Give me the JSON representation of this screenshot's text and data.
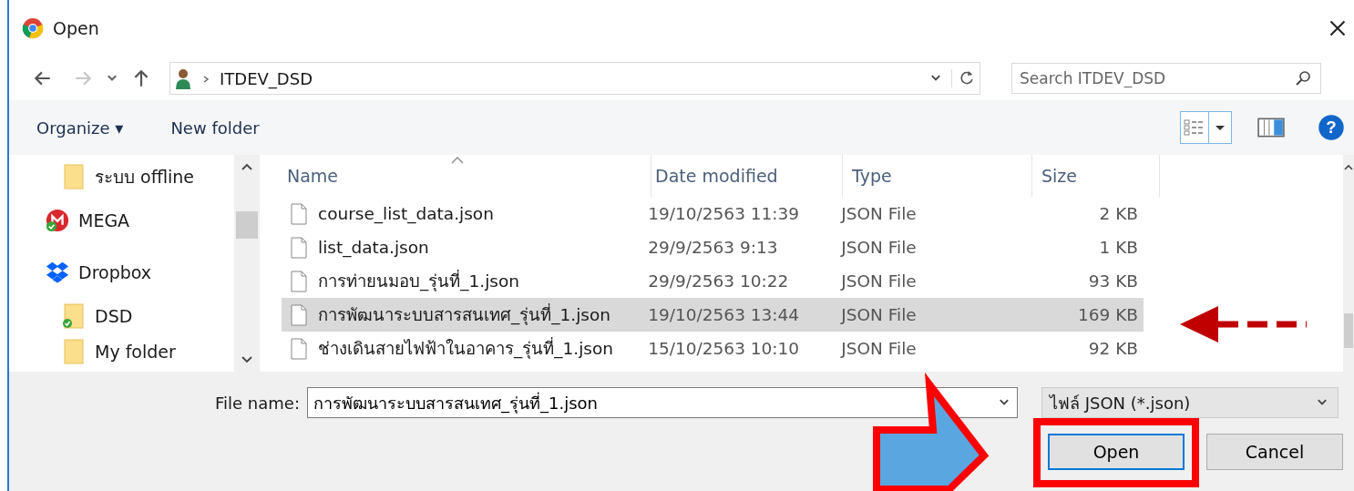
{
  "window": {
    "title": "Open"
  },
  "nav": {
    "path": "ITDEV_DSD",
    "search_placeholder": "Search ITDEV_DSD"
  },
  "toolbar": {
    "organize": "Organize ▾",
    "new_folder": "New folder",
    "help": "?"
  },
  "sidebar": {
    "items": [
      {
        "label": "ระบบ offline",
        "kind": "folder"
      },
      {
        "label": "MEGA",
        "kind": "mega"
      },
      {
        "label": "Dropbox",
        "kind": "dropbox"
      },
      {
        "label": "DSD",
        "kind": "synced-folder"
      },
      {
        "label": "My folder",
        "kind": "folder"
      }
    ]
  },
  "table": {
    "columns": [
      "Name",
      "Date modified",
      "Type",
      "Size"
    ],
    "rows": [
      {
        "name": "course_list_data.json",
        "date": "19/10/2563 11:39",
        "type": "JSON File",
        "size": "2 KB",
        "selected": false
      },
      {
        "name": "list_data.json",
        "date": "29/9/2563 9:13",
        "type": "JSON File",
        "size": "1 KB",
        "selected": false
      },
      {
        "name": "การท่ายนมอบ_รุ่นที่_1.json",
        "date": "29/9/2563 10:22",
        "type": "JSON File",
        "size": "93 KB",
        "selected": false
      },
      {
        "name": "การพัฒนาระบบสารสนเทศ_รุ่นที่_1.json",
        "date": "19/10/2563 13:44",
        "type": "JSON File",
        "size": "169 KB",
        "selected": true
      },
      {
        "name": "ช่างเดินสายไฟฟ้าในอาคาร_รุ่นที่_1.json",
        "date": "15/10/2563 10:10",
        "type": "JSON File",
        "size": "92 KB",
        "selected": false
      }
    ]
  },
  "footer": {
    "file_name_label": "File name:",
    "file_name": "การพัฒนาระบบสารสนเทศ_รุ่นที่_1.json",
    "filter": "ไฟล์ JSON (*.json)",
    "buttons": [
      "Open",
      "Cancel"
    ]
  }
}
